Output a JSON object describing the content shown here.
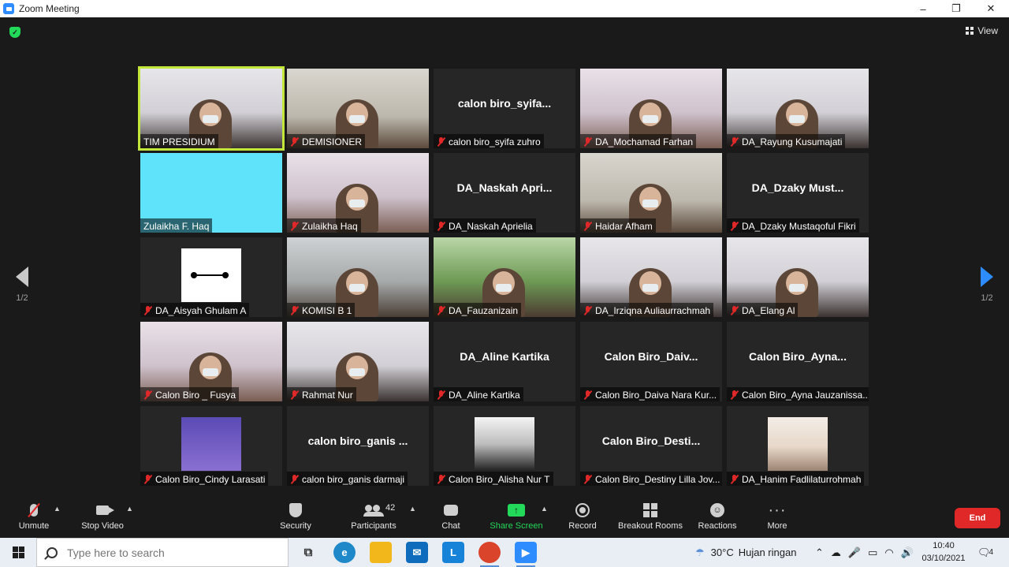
{
  "window": {
    "title": "Zoom Meeting",
    "controls": [
      "–",
      "❐",
      "✕"
    ]
  },
  "meeting": {
    "view_label": "View",
    "page_left": "1/2",
    "page_right": "1/2",
    "tiles": [
      {
        "name": "TIM PRESIDIUM",
        "video": true,
        "style": "poster",
        "active": true,
        "muted": false
      },
      {
        "name": "DEMISIONER",
        "video": true,
        "style": "room",
        "muted": true
      },
      {
        "name": "calon biro_syifa zuhro",
        "big": "calon  biro_syifa...",
        "video": false,
        "muted": true
      },
      {
        "name": "DA_Mochamad Farhan",
        "video": true,
        "style": "pink",
        "muted": true
      },
      {
        "name": "DA_Rayung Kusumajati",
        "video": true,
        "style": "poster",
        "muted": true
      },
      {
        "name": "Zulaikha F. Haq",
        "video": true,
        "style": "cyan",
        "muted": false
      },
      {
        "name": "Zulaikha Haq",
        "video": true,
        "style": "pink",
        "muted": true
      },
      {
        "name": "DA_Naskah Aprielia",
        "big": "DA_Naskah  Apri...",
        "video": false,
        "muted": true
      },
      {
        "name": "Haidar Afham",
        "video": true,
        "style": "room",
        "muted": true
      },
      {
        "name": "DA_Dzaky Mustaqoful Fikri",
        "big": "DA_Dzaky  Must...",
        "video": false,
        "muted": true
      },
      {
        "name": "DA_Aisyah Ghulam A",
        "thumb": "dot",
        "video": false,
        "muted": true
      },
      {
        "name": "KOMISI B 1",
        "video": true,
        "style": "room2",
        "muted": true
      },
      {
        "name": "DA_Fauzanizain",
        "video": true,
        "style": "green",
        "muted": true
      },
      {
        "name": "DA_Irziqna Auliaurrachmah",
        "video": true,
        "style": "poster",
        "muted": true
      },
      {
        "name": "DA_Elang Al",
        "video": true,
        "style": "poster",
        "muted": true
      },
      {
        "name": "Calon Biro _ Fusya",
        "video": true,
        "style": "pink",
        "muted": true
      },
      {
        "name": "Rahmat Nur",
        "video": true,
        "style": "poster",
        "muted": true
      },
      {
        "name": "DA_Aline Kartika",
        "big": "DA_Aline Kartika",
        "video": false,
        "muted": true
      },
      {
        "name": "Calon Biro_Daiva Nara Kur...",
        "big": "Calon  Biro_Daiv...",
        "video": false,
        "muted": true
      },
      {
        "name": "Calon Biro_Ayna Jauzanissa...",
        "big": "Calon  Biro_Ayna...",
        "video": false,
        "muted": true
      },
      {
        "name": "Calon Biro_Cindy Larasati",
        "thumb": "purple",
        "video": false,
        "muted": true
      },
      {
        "name": "calon biro_ganis darmaji",
        "big": "calon  biro_ganis ...",
        "video": false,
        "muted": true
      },
      {
        "name": "Calon Biro_Alisha Nur T",
        "thumb": "mono",
        "video": false,
        "muted": true
      },
      {
        "name": "Calon Biro_Destiny Lilla Jov...",
        "big": "Calon  Biro_Desti...",
        "video": false,
        "muted": true
      },
      {
        "name": "DA_Hanim Fadlilaturrohmah",
        "thumb": "sky",
        "video": false,
        "muted": true
      }
    ]
  },
  "toolbar": {
    "unmute": "Unmute",
    "stop_video": "Stop Video",
    "security": "Security",
    "participants": "Participants",
    "participants_count": "42",
    "chat": "Chat",
    "share_screen": "Share Screen",
    "record": "Record",
    "breakout_rooms": "Breakout Rooms",
    "reactions": "Reactions",
    "more": "More",
    "end": "End"
  },
  "taskbar": {
    "search_placeholder": "Type here to search",
    "weather_temp": "30°C",
    "weather_desc": "Hujan ringan",
    "time": "10:40",
    "date": "03/10/2021",
    "notifications": "4",
    "apps": [
      "task-view",
      "edge",
      "file-explorer",
      "mail",
      "l-app",
      "chrome",
      "zoom"
    ]
  }
}
